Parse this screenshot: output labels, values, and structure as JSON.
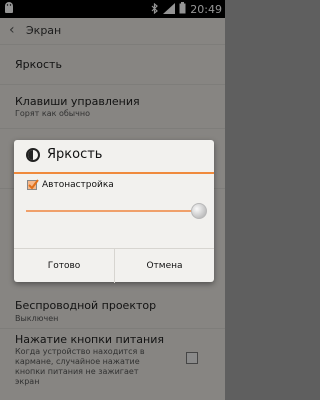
{
  "status_bar": {
    "time": "20:49",
    "icons": [
      "android-icon",
      "bluetooth-icon",
      "signal-icon",
      "battery-icon"
    ]
  },
  "action_bar": {
    "title": "Экран"
  },
  "settings": [
    {
      "title": "Яркость"
    },
    {
      "title": "Клавиши управления",
      "subtitle": "Горят как обычно"
    },
    {
      "title": "Беспроводной проектор",
      "subtitle": "Выключен"
    },
    {
      "title": "Нажатие кнопки питания",
      "subtitle": "Когда устройство находится в кармане, случайное нажатие кнопки питания не зажигает экран",
      "checked": false
    }
  ],
  "dialog": {
    "title": "Яркость",
    "auto_label": "Автонастройка",
    "auto_checked": true,
    "brightness_level": 1.0,
    "ok_label": "Готово",
    "cancel_label": "Отмена"
  },
  "colors": {
    "accent": "#f08a3c",
    "background": "#e8e6e1",
    "status_bar": "#000000"
  }
}
